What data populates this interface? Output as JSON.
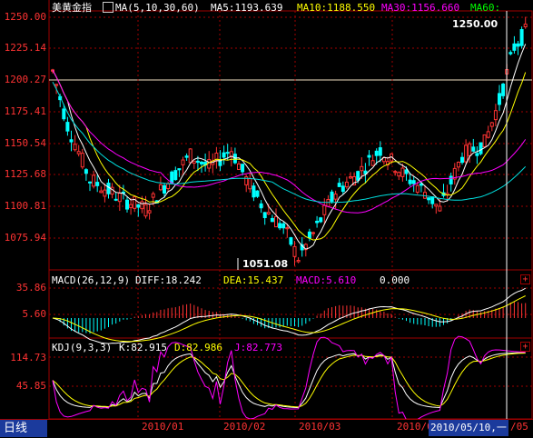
{
  "main_panel": {
    "title": "美黄金指",
    "indicator_name": "MA(5,10,30,60)",
    "ma5": "MA5:1193.639",
    "ma10": "MA10:1188.550",
    "ma30": "MA30:1156.660",
    "ma60": "MA60:",
    "high_marker": "1250.00",
    "low_marker": "1051.08",
    "y_ticks": [
      "1250.00",
      "1225.14",
      "1200.27",
      "1175.41",
      "1150.54",
      "1125.68",
      "1100.81",
      "1075.94"
    ]
  },
  "macd_panel": {
    "title": "MACD(26,12,9)",
    "diff": "DIFF:18.242",
    "dea": "DEA:15.437",
    "macd": "MACD:5.610",
    "zero": "0.000",
    "y_ticks": [
      "35.86",
      "5.60"
    ]
  },
  "kdj_panel": {
    "title": "KDJ(9,3,3)",
    "k": "K:82.915",
    "d": "D:82.986",
    "j": "J:82.773",
    "y_ticks": [
      "114.73",
      "45.85"
    ]
  },
  "bottom_bar": {
    "period_tab": "日线",
    "x_dates": [
      "2010/01",
      "2010/02",
      "2010/03",
      "2010/0"
    ],
    "cursor_date": "2010/05/10,一",
    "cursor_suffix": "/05"
  },
  "colors": {
    "up": "#ff3333",
    "down": "#00ffff",
    "ma5": "#ffffff",
    "ma10": "#ffff00",
    "ma30": "#ff00ff",
    "ma60": "#00ff00",
    "grid": "#a00000"
  },
  "chart_data": {
    "type": "candlestick",
    "y_range": [
      1051.08,
      1250.0
    ]
  }
}
